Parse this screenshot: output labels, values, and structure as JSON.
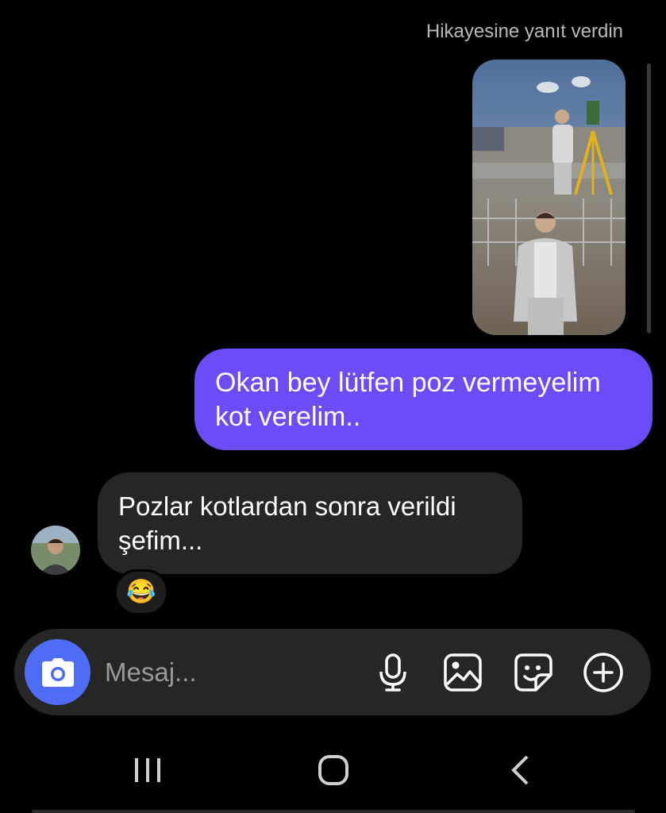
{
  "header": {
    "story_reply_label": "Hikayesine yanıt verdin"
  },
  "messages": {
    "outgoing": {
      "text": "Okan bey lütfen poz vermeyelim\nkot verelim.."
    },
    "incoming": {
      "text": "Pozlar kotlardan sonra  verildi\nşefim...",
      "reaction_emoji": "😂"
    }
  },
  "composer": {
    "placeholder": "Mesaj...",
    "icons": [
      "camera-icon",
      "microphone-icon",
      "gallery-icon",
      "sticker-icon",
      "add-icon"
    ]
  },
  "navbar": {
    "icons": [
      "recent-apps-icon",
      "home-icon",
      "back-icon"
    ]
  },
  "colors": {
    "background": "#000000",
    "outgoing_bubble": "#6b4cf6",
    "incoming_bubble": "#262626",
    "composer": "#262626",
    "camera_button": "#4e6cf5",
    "secondary_text": "#b9b9b9"
  }
}
